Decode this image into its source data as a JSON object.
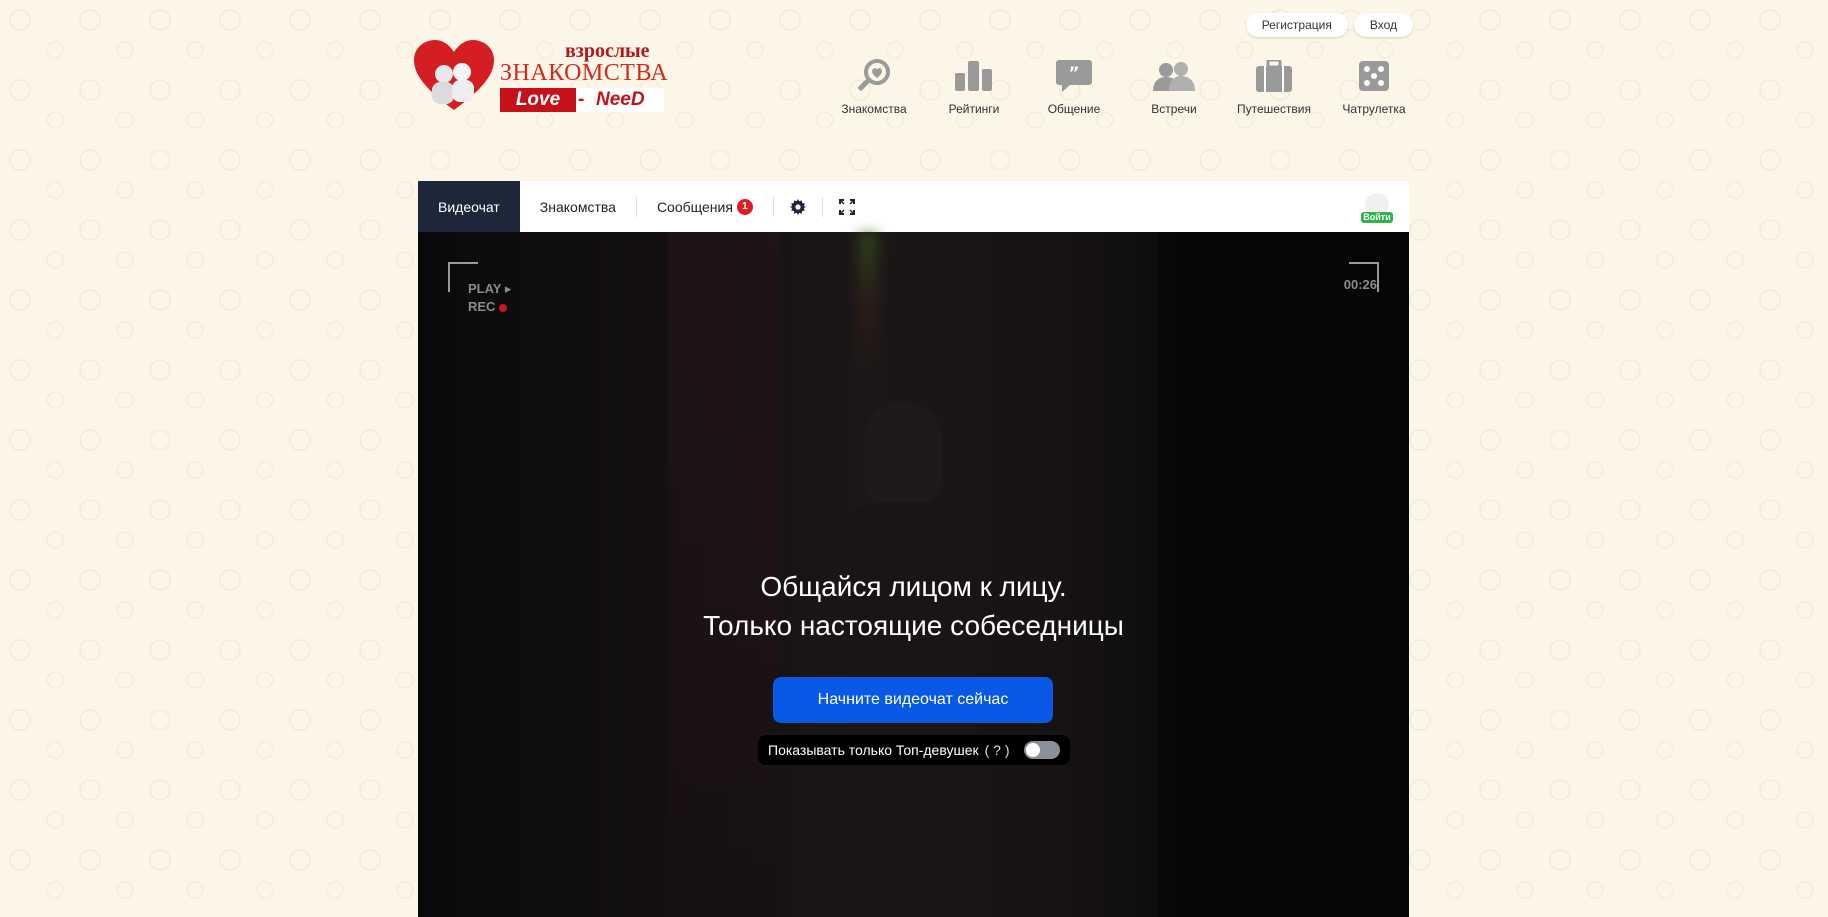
{
  "auth": {
    "register": "Регистрация",
    "login": "Вход"
  },
  "logo": {
    "adult": "взрослые",
    "main": "ЗНАКОМСТВА",
    "love": "Love",
    "dash": "-",
    "need": "NeeD"
  },
  "nav": [
    {
      "label": "Знакомства",
      "icon": "search-heart-icon"
    },
    {
      "label": "Рейтинги",
      "icon": "ratings-icon"
    },
    {
      "label": "Общение",
      "icon": "chat-icon"
    },
    {
      "label": "Встречи",
      "icon": "people-icon"
    },
    {
      "label": "Путешествия",
      "icon": "suitcase-icon"
    },
    {
      "label": "Чатрулетка",
      "icon": "dice-icon"
    }
  ],
  "tabs": {
    "videochat": "Видеочат",
    "dating": "Знакомства",
    "messages": "Сообщения",
    "messages_count": "1"
  },
  "login_mini": "Войти",
  "video": {
    "play": "PLAY ▸",
    "rec": "REC",
    "timer": "00:26",
    "headline_1": "Общайся лицом к лицу.",
    "headline_2": "Только настоящие собеседницы",
    "cta": "Начните видеочат сейчас",
    "filter_label": "Показывать только Топ-девушек",
    "filter_help": "( ? )"
  },
  "colors": {
    "accent": "#0a58e6",
    "tab_active": "#1d2739",
    "brand_red": "#c5121a",
    "badge": "#e01b24"
  }
}
